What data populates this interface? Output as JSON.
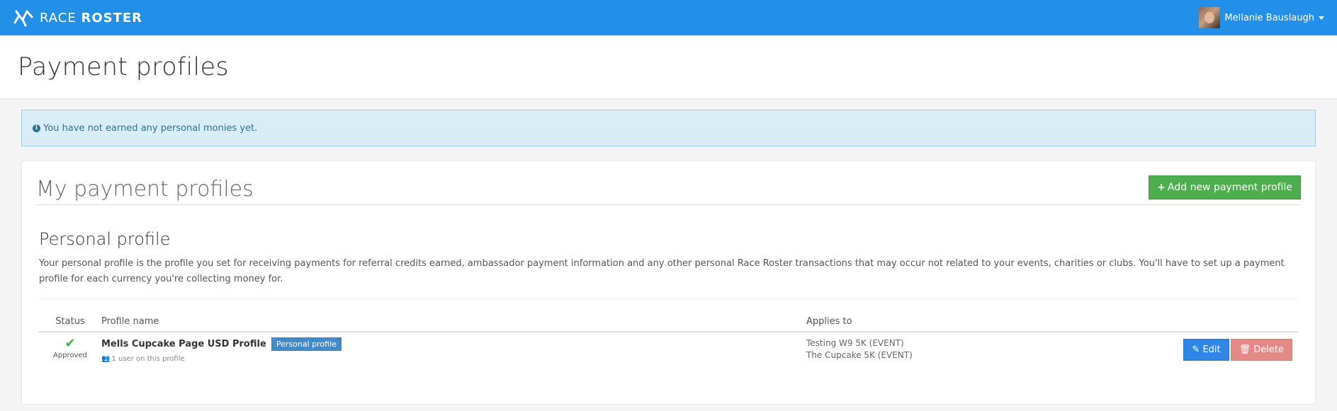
{
  "header": {
    "logo_text_light": "RACE",
    "logo_text_bold": "ROSTER",
    "user_name": "Mellanie Bauslaugh"
  },
  "page": {
    "title": "Payment profiles"
  },
  "alert": {
    "icon": "info-icon",
    "text": "You have not earned any personal monies yet."
  },
  "panel": {
    "title": "My payment profiles",
    "add_button_label": "Add new payment profile",
    "add_button_icon": "plus-icon"
  },
  "personal": {
    "title": "Personal profile",
    "description": "Your personal profile is the profile you set for receiving payments for referral credits earned, ambassador payment information and any other personal Race Roster transactions that may occur not related to your events, charities or clubs. You'll have to set up a payment profile for each currency you're collecting money for."
  },
  "table": {
    "columns": [
      "Status",
      "Profile name",
      "Applies to"
    ],
    "rows": [
      {
        "status_icon": "check-icon",
        "status": "Approved",
        "profile_name": "Mells Cupcake Page USD Profile",
        "badge": "Personal profile",
        "users": "1 user on this profile",
        "applies_to": [
          "Testing W9 5K (EVENT)",
          "The Cupcake 5K (EVENT)"
        ],
        "edit_label": "Edit",
        "delete_label": "Delete"
      }
    ]
  },
  "colors": {
    "topbar": "#2290e8",
    "success": "#4cae4c",
    "primary": "#2f86e8",
    "danger": "#e38a87",
    "info_bg": "#d9edf7"
  }
}
